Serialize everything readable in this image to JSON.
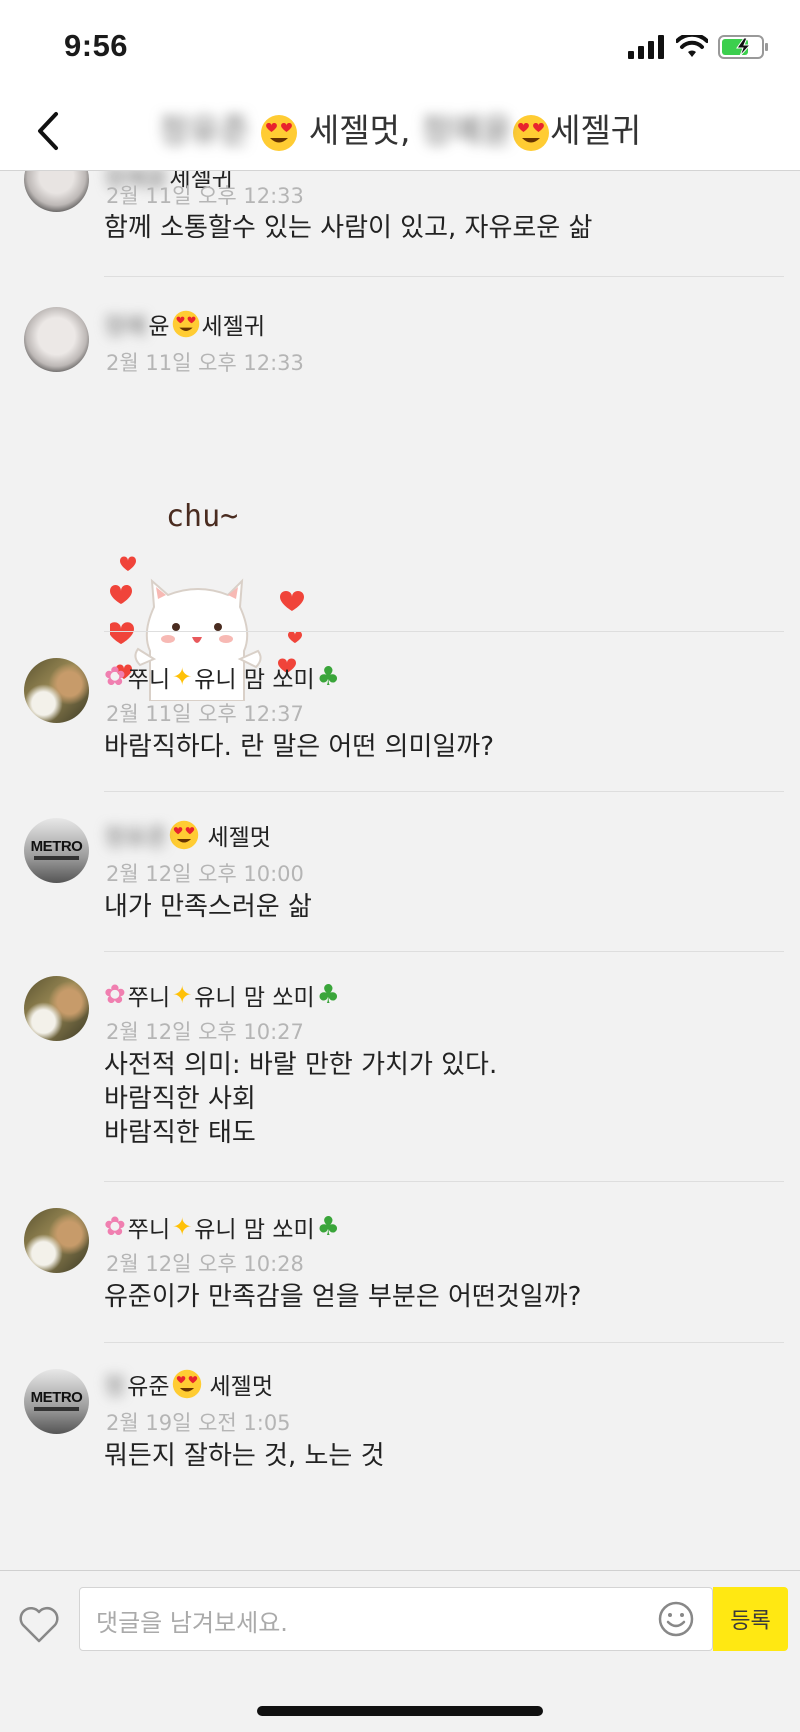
{
  "status_bar": {
    "time": "9:56"
  },
  "header": {
    "title_blur_1": "정유준",
    "title_mid": "세젤멋,",
    "title_blur_2": "정예윤",
    "title_end": "세젤귀"
  },
  "messages": [
    {
      "name_blur": "정예윤",
      "name_suffix": "세젤귀",
      "date": "2월 11일 오후 12:33",
      "lines": [
        "함께 소통할수 있는 사람이 있고, 자유로운 삶"
      ]
    },
    {
      "name_blur": "정예",
      "name_prefix": "윤",
      "name_suffix": "세젤귀",
      "date": "2월 11일 오후 12:33",
      "sticker_text": "chu~"
    },
    {
      "name": "쭈니",
      "name_mid": "유니 맘 쏘미",
      "date": "2월 11일 오후 12:37",
      "lines": [
        "바람직하다. 란 말은 어떤 의미일까?"
      ]
    },
    {
      "name_blur": "정유준",
      "name_suffix": "세젤멋",
      "date": "2월 12일 오후 10:00",
      "lines": [
        "내가 만족스러운 삶"
      ]
    },
    {
      "name": "쭈니",
      "name_mid": "유니 맘 쏘미",
      "date": "2월 12일 오후 10:27",
      "lines": [
        "사전적 의미: 바랄 만한 가치가 있다.",
        "바람직한 사회",
        "바람직한 태도"
      ]
    },
    {
      "name": "쭈니",
      "name_mid": "유니 맘 쏘미",
      "date": "2월 12일 오후 10:28",
      "lines": [
        "유준이가 만족감을 얻을 부분은 어떤것일까?"
      ]
    },
    {
      "name_blur": "정",
      "name_prefix": "유준",
      "name_suffix": "세젤멋",
      "date": "2월 19일 오전 1:05",
      "lines": [
        "뭐든지 잘하는 것, 노는 것"
      ]
    }
  ],
  "avatar_text": {
    "metro": "METRO"
  },
  "composer": {
    "placeholder": "댓글을 남겨보세요.",
    "submit_label": "등록"
  }
}
